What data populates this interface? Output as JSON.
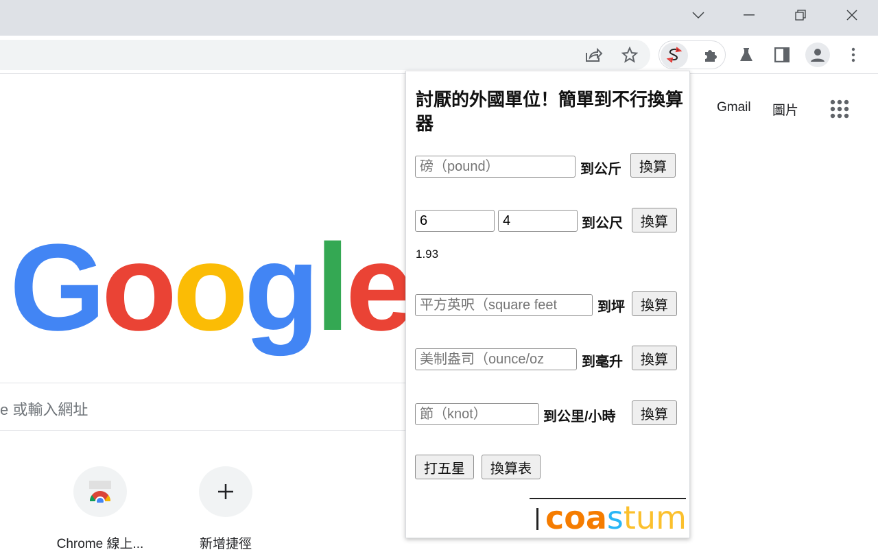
{
  "window": {
    "controls": [
      "tab-search",
      "minimize",
      "restore",
      "close"
    ]
  },
  "toolbar": {
    "icons": [
      "share-icon",
      "star-icon",
      "converter-extension-icon",
      "puzzle-extensions-icon",
      "labs-flask-icon",
      "side-panel-icon",
      "profile-avatar-icon",
      "kebab-menu-icon"
    ],
    "accent": "#ea4335"
  },
  "ntp": {
    "links": {
      "gmail": "Gmail",
      "images": "圖片"
    },
    "logo": {
      "letters": [
        "G",
        "o",
        "o",
        "g",
        "l",
        "e"
      ],
      "colors": [
        "#4285f4",
        "#ea4335",
        "#fbbc05",
        "#4285f4",
        "#34a853",
        "#ea4335"
      ]
    },
    "search_placeholder_visible": "e 或輸入網址",
    "shortcuts": [
      {
        "label": "Chrome 線上..."
      },
      {
        "label": "新增捷徑",
        "icon": "plus-icon"
      }
    ]
  },
  "popup": {
    "title": "討厭的外國單位！簡單到不行換算器",
    "convert_label": "換算",
    "rows": [
      {
        "placeholder": "磅（pound）",
        "unit": "到公斤"
      },
      {
        "value1": "6",
        "value2": "4",
        "unit": "到公尺",
        "result": "1.93"
      },
      {
        "placeholder": "平方英呎（square feet",
        "unit": "到坪"
      },
      {
        "placeholder": "美制盎司（ounce/oz",
        "unit": "到毫升"
      },
      {
        "placeholder": "節（knot）",
        "unit": "到公里/小時"
      }
    ],
    "rate_button": "打五星",
    "table_button": "換算表",
    "brand": {
      "part1": "coa",
      "part2": "s",
      "part3": "tum",
      "colors": [
        "#f57c00",
        "#29b6f6",
        "#fbc02d"
      ]
    }
  }
}
